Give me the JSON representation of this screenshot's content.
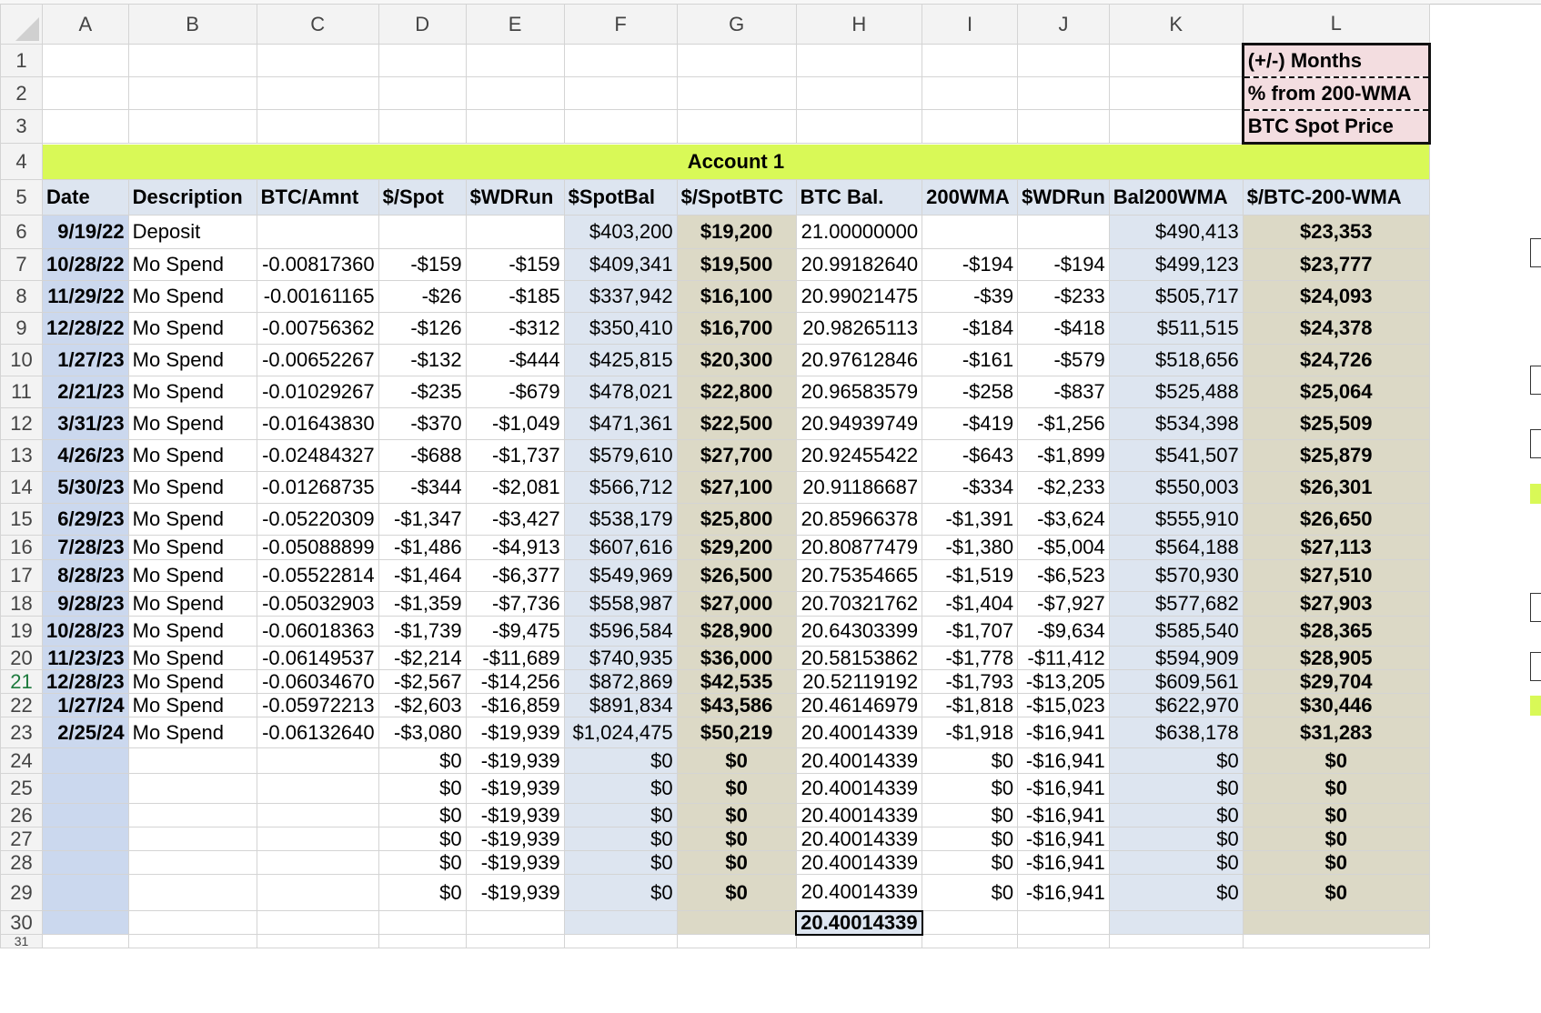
{
  "columns": [
    "A",
    "B",
    "C",
    "D",
    "E",
    "F",
    "G",
    "H",
    "I",
    "J",
    "K",
    "L"
  ],
  "legend": [
    "(+/-)  Months",
    "% from 200-WMA",
    "BTC Spot Price"
  ],
  "banner": "Account 1",
  "headers": [
    "Date",
    "Description",
    "BTC/Amnt",
    "$/Spot",
    "$WDRun",
    "$SpotBal",
    "$/SpotBTC",
    "BTC Bal.",
    "200WMA",
    "$WDRun",
    "Bal200WMA",
    "$/BTC-200-WMA"
  ],
  "rows": [
    [
      "9/19/22",
      "Deposit",
      "",
      "",
      "",
      "$403,200",
      "$19,200",
      "21.00000000",
      "",
      "",
      "$490,413",
      "$23,353"
    ],
    [
      "10/28/22",
      "Mo  Spend",
      "-0.00817360",
      "-$159",
      "-$159",
      "$409,341",
      "$19,500",
      "20.99182640",
      "-$194",
      "-$194",
      "$499,123",
      "$23,777"
    ],
    [
      "11/29/22",
      "Mo  Spend",
      "-0.00161165",
      "-$26",
      "-$185",
      "$337,942",
      "$16,100",
      "20.99021475",
      "-$39",
      "-$233",
      "$505,717",
      "$24,093"
    ],
    [
      "12/28/22",
      "Mo  Spend",
      "-0.00756362",
      "-$126",
      "-$312",
      "$350,410",
      "$16,700",
      "20.98265113",
      "-$184",
      "-$418",
      "$511,515",
      "$24,378"
    ],
    [
      "1/27/23",
      "Mo  Spend",
      "-0.00652267",
      "-$132",
      "-$444",
      "$425,815",
      "$20,300",
      "20.97612846",
      "-$161",
      "-$579",
      "$518,656",
      "$24,726"
    ],
    [
      "2/21/23",
      "Mo  Spend",
      "-0.01029267",
      "-$235",
      "-$679",
      "$478,021",
      "$22,800",
      "20.96583579",
      "-$258",
      "-$837",
      "$525,488",
      "$25,064"
    ],
    [
      "3/31/23",
      "Mo  Spend",
      "-0.01643830",
      "-$370",
      "-$1,049",
      "$471,361",
      "$22,500",
      "20.94939749",
      "-$419",
      "-$1,256",
      "$534,398",
      "$25,509"
    ],
    [
      "4/26/23",
      "Mo  Spend",
      "-0.02484327",
      "-$688",
      "-$1,737",
      "$579,610",
      "$27,700",
      "20.92455422",
      "-$643",
      "-$1,899",
      "$541,507",
      "$25,879"
    ],
    [
      "5/30/23",
      "Mo  Spend",
      "-0.01268735",
      "-$344",
      "-$2,081",
      "$566,712",
      "$27,100",
      "20.91186687",
      "-$334",
      "-$2,233",
      "$550,003",
      "$26,301"
    ],
    [
      "6/29/23",
      "Mo  Spend",
      "-0.05220309",
      "-$1,347",
      "-$3,427",
      "$538,179",
      "$25,800",
      "20.85966378",
      "-$1,391",
      "-$3,624",
      "$555,910",
      "$26,650"
    ],
    [
      "7/28/23",
      "Mo  Spend",
      "-0.05088899",
      "-$1,486",
      "-$4,913",
      "$607,616",
      "$29,200",
      "20.80877479",
      "-$1,380",
      "-$5,004",
      "$564,188",
      "$27,113"
    ],
    [
      "8/28/23",
      "Mo  Spend",
      "-0.05522814",
      "-$1,464",
      "-$6,377",
      "$549,969",
      "$26,500",
      "20.75354665",
      "-$1,519",
      "-$6,523",
      "$570,930",
      "$27,510"
    ],
    [
      "9/28/23",
      "Mo  Spend",
      "-0.05032903",
      "-$1,359",
      "-$7,736",
      "$558,987",
      "$27,000",
      "20.70321762",
      "-$1,404",
      "-$7,927",
      "$577,682",
      "$27,903"
    ],
    [
      "10/28/23",
      "Mo  Spend",
      "-0.06018363",
      "-$1,739",
      "-$9,475",
      "$596,584",
      "$28,900",
      "20.64303399",
      "-$1,707",
      "-$9,634",
      "$585,540",
      "$28,365"
    ],
    [
      "11/23/23",
      "Mo  Spend",
      "-0.06149537",
      "-$2,214",
      "-$11,689",
      "$740,935",
      "$36,000",
      "20.58153862",
      "-$1,778",
      "-$11,412",
      "$594,909",
      "$28,905"
    ],
    [
      "12/28/23",
      "Mo  Spend",
      "-0.06034670",
      "-$2,567",
      "-$14,256",
      "$872,869",
      "$42,535",
      "20.52119192",
      "-$1,793",
      "-$13,205",
      "$609,561",
      "$29,704"
    ],
    [
      "1/27/24",
      "Mo  Spend",
      "-0.05972213",
      "-$2,603",
      "-$16,859",
      "$891,834",
      "$43,586",
      "20.46146979",
      "-$1,818",
      "-$15,023",
      "$622,970",
      "$30,446"
    ],
    [
      "2/25/24",
      "Mo  Spend",
      "-0.06132640",
      "-$3,080",
      "-$19,939",
      "$1,024,475",
      "$50,219",
      "20.40014339",
      "-$1,918",
      "-$16,941",
      "$638,178",
      "$31,283"
    ],
    [
      "",
      "",
      "",
      "$0",
      "-$19,939",
      "$0",
      "$0",
      "20.40014339",
      "$0",
      "-$16,941",
      "$0",
      "$0"
    ],
    [
      "",
      "",
      "",
      "$0",
      "-$19,939",
      "$0",
      "$0",
      "20.40014339",
      "$0",
      "-$16,941",
      "$0",
      "$0"
    ],
    [
      "",
      "",
      "",
      "$0",
      "-$19,939",
      "$0",
      "$0",
      "20.40014339",
      "$0",
      "-$16,941",
      "$0",
      "$0"
    ],
    [
      "",
      "",
      "",
      "$0",
      "-$19,939",
      "$0",
      "$0",
      "20.40014339",
      "$0",
      "-$16,941",
      "$0",
      "$0"
    ],
    [
      "",
      "",
      "",
      "$0",
      "-$19,939",
      "$0",
      "$0",
      "20.40014339",
      "$0",
      "-$16,941",
      "$0",
      "$0"
    ],
    [
      "",
      "",
      "",
      "$0",
      "-$19,939",
      "$0",
      "$0",
      "20.40014339",
      "$0",
      "-$16,941",
      "$0",
      "$0"
    ],
    [
      "",
      "",
      "",
      "",
      "",
      "",
      "",
      "20.40014339",
      "",
      "",
      "",
      ""
    ]
  ],
  "colors": {
    "banner": "#d9f957",
    "date_column": "#cbd8ee",
    "light_blue": "#dde5f0",
    "tan": "#dcd9c6",
    "legend": "#f3dde0"
  }
}
